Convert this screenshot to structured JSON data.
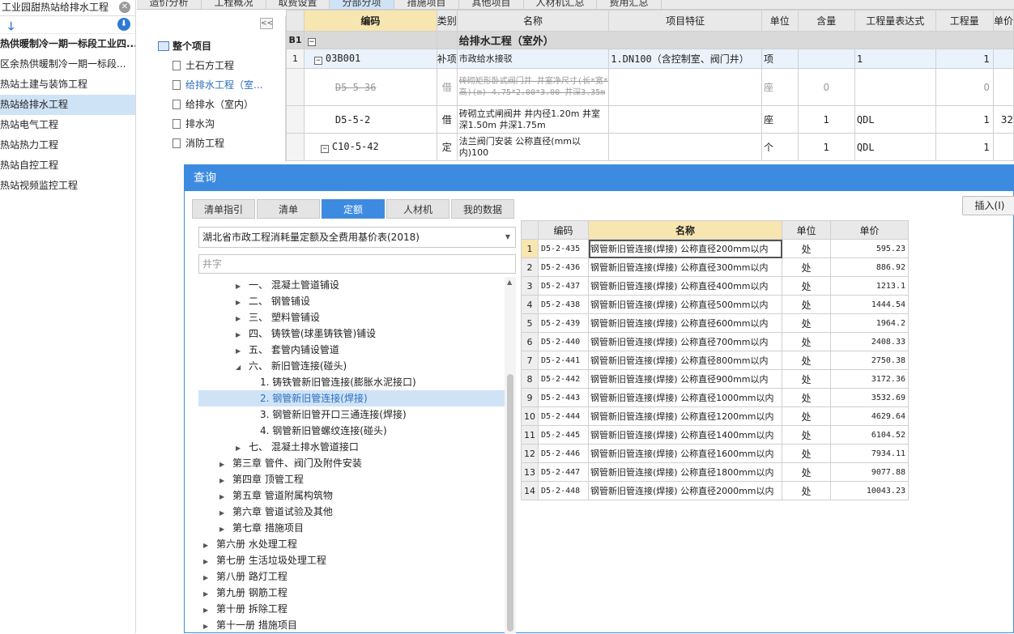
{
  "left_panel": {
    "title": "工业园甜热站给排水工程",
    "items": [
      {
        "label": "热供暖制冷一期一标段工业四...",
        "bold": true
      },
      {
        "label": "区余热供暖制冷一期一标段..."
      },
      {
        "label": "热站土建与装饰工程"
      },
      {
        "label": "热站给排水工程",
        "selected": true
      },
      {
        "label": "热站电气工程"
      },
      {
        "label": "热站热力工程"
      },
      {
        "label": "热站自控工程"
      },
      {
        "label": "热站视频监控工程"
      }
    ]
  },
  "top_tabs": [
    {
      "label": "造价分析"
    },
    {
      "label": "工程概况"
    },
    {
      "label": "取费设置"
    },
    {
      "label": "分部分项",
      "active": true
    },
    {
      "label": "措施项目"
    },
    {
      "label": "其他项目"
    },
    {
      "label": "人材机汇总"
    },
    {
      "label": "费用汇总"
    }
  ],
  "project_tree": {
    "collapse_label": "<<",
    "root": "整个项目",
    "children": [
      {
        "label": "土石方工程"
      },
      {
        "label": "给排水工程（室...",
        "selected": true
      },
      {
        "label": "给排水（室内）"
      },
      {
        "label": "排水沟"
      },
      {
        "label": "消防工程"
      }
    ]
  },
  "top_grid": {
    "headers": [
      "编码",
      "类别",
      "名称",
      "项目特征",
      "单位",
      "含量",
      "工程量表达式",
      "工程量",
      "单价"
    ],
    "section": {
      "idx": "B1",
      "name": "给排水工程（室外）"
    },
    "rows": [
      {
        "idx": "1",
        "code": "03B001",
        "type": "补项",
        "name": "市政给水接驳",
        "feature": "1.DN100（含控制室、阀门井）",
        "unit": "项",
        "content": "",
        "expr": "1",
        "qty": "1",
        "price": ""
      },
      {
        "idx": "",
        "code": "D5-5-36",
        "type": "借",
        "name": "砖砌矩形卧式阀门井 井室净尺寸(长*宽*高)(m) 4.75*2.00*3.00 井深3.35m",
        "feature": "",
        "unit": "座",
        "content": "0",
        "expr": "",
        "qty": "0",
        "price": "",
        "strike": true
      },
      {
        "idx": "",
        "code": "D5-5-2",
        "type": "借",
        "name": "砖砌立式闸阀井 井内径1.20m 井室深1.50m 井深1.75m",
        "feature": "",
        "unit": "座",
        "content": "1",
        "expr": "QDL",
        "qty": "1",
        "price": "32"
      },
      {
        "idx": "",
        "code": "C10-5-42",
        "type": "定",
        "name": "法兰阀门安装 公称直径(mm以内)100",
        "feature": "",
        "unit": "个",
        "content": "1",
        "expr": "QDL",
        "qty": "1",
        "price": ""
      }
    ]
  },
  "dialog": {
    "title": "查询",
    "tabs": [
      {
        "label": "清单指引"
      },
      {
        "label": "清单"
      },
      {
        "label": "定额",
        "active": true
      },
      {
        "label": "人材机"
      },
      {
        "label": "我的数据"
      }
    ],
    "insert_label": "插入(I)",
    "library": "湖北省市政工程消耗量定额及全费用基价表(2018)",
    "search_placeholder": "井字",
    "tree": [
      {
        "label": "一、 混凝土管道铺设",
        "level": 3,
        "expand": "right"
      },
      {
        "label": "二、 钢管铺设",
        "level": 3,
        "expand": "right"
      },
      {
        "label": "三、 塑料管铺设",
        "level": 3,
        "expand": "right"
      },
      {
        "label": "四、 铸铁管(球墨铸铁管)铺设",
        "level": 3,
        "expand": "right"
      },
      {
        "label": "五、 套管内铺设管道",
        "level": 3,
        "expand": "right"
      },
      {
        "label": "六、 新旧管连接(碰头)",
        "level": 3,
        "expand": "down"
      },
      {
        "label": "1. 铸铁管新旧管连接(膨胀水泥接口)",
        "level": 4
      },
      {
        "label": "2. 钢管新旧管连接(焊接)",
        "level": 4,
        "selected": true
      },
      {
        "label": "3. 钢管新旧管开口三通连接(焊接)",
        "level": 4
      },
      {
        "label": "4. 钢管新旧管螺纹连接(碰头)",
        "level": 4
      },
      {
        "label": "七、 混凝土排水管道接口",
        "level": 3,
        "expand": "right"
      },
      {
        "label": "第三章 管件、阀门及附件安装",
        "level": 2,
        "expand": "right"
      },
      {
        "label": "第四章 顶管工程",
        "level": 2,
        "expand": "right"
      },
      {
        "label": "第五章 管道附属构筑物",
        "level": 2,
        "expand": "right"
      },
      {
        "label": "第六章 管道试验及其他",
        "level": 2,
        "expand": "right"
      },
      {
        "label": "第七章 措施项目",
        "level": 2,
        "expand": "right"
      },
      {
        "label": "第六册 水处理工程",
        "level": 1,
        "expand": "right"
      },
      {
        "label": "第七册 生活垃圾处理工程",
        "level": 1,
        "expand": "right"
      },
      {
        "label": "第八册 路灯工程",
        "level": 1,
        "expand": "right"
      },
      {
        "label": "第九册 钢筋工程",
        "level": 1,
        "expand": "right"
      },
      {
        "label": "第十册 拆除工程",
        "level": 1,
        "expand": "right"
      },
      {
        "label": "第十一册 措施项目",
        "level": 1,
        "expand": "right"
      }
    ],
    "result_headers": [
      "编码",
      "名称",
      "单位",
      "单价"
    ],
    "results": [
      {
        "idx": "1",
        "code": "D5-2-435",
        "name": "钢管新旧管连接(焊接) 公称直径200mm以内",
        "unit": "处",
        "price": "595.23"
      },
      {
        "idx": "2",
        "code": "D5-2-436",
        "name": "钢管新旧管连接(焊接) 公称直径300mm以内",
        "unit": "处",
        "price": "886.92"
      },
      {
        "idx": "3",
        "code": "D5-2-437",
        "name": "钢管新旧管连接(焊接) 公称直径400mm以内",
        "unit": "处",
        "price": "1213.1"
      },
      {
        "idx": "4",
        "code": "D5-2-438",
        "name": "钢管新旧管连接(焊接) 公称直径500mm以内",
        "unit": "处",
        "price": "1444.54"
      },
      {
        "idx": "5",
        "code": "D5-2-439",
        "name": "钢管新旧管连接(焊接) 公称直径600mm以内",
        "unit": "处",
        "price": "1964.2"
      },
      {
        "idx": "6",
        "code": "D5-2-440",
        "name": "钢管新旧管连接(焊接) 公称直径700mm以内",
        "unit": "处",
        "price": "2408.33"
      },
      {
        "idx": "7",
        "code": "D5-2-441",
        "name": "钢管新旧管连接(焊接) 公称直径800mm以内",
        "unit": "处",
        "price": "2750.38"
      },
      {
        "idx": "8",
        "code": "D5-2-442",
        "name": "钢管新旧管连接(焊接) 公称直径900mm以内",
        "unit": "处",
        "price": "3172.36"
      },
      {
        "idx": "9",
        "code": "D5-2-443",
        "name": "钢管新旧管连接(焊接) 公称直径1000mm以内",
        "unit": "处",
        "price": "3532.69"
      },
      {
        "idx": "10",
        "code": "D5-2-444",
        "name": "钢管新旧管连接(焊接) 公称直径1200mm以内",
        "unit": "处",
        "price": "4629.64"
      },
      {
        "idx": "11",
        "code": "D5-2-445",
        "name": "钢管新旧管连接(焊接) 公称直径1400mm以内",
        "unit": "处",
        "price": "6104.52"
      },
      {
        "idx": "12",
        "code": "D5-2-446",
        "name": "钢管新旧管连接(焊接) 公称直径1600mm以内",
        "unit": "处",
        "price": "7934.11"
      },
      {
        "idx": "13",
        "code": "D5-2-447",
        "name": "钢管新旧管连接(焊接) 公称直径1800mm以内",
        "unit": "处",
        "price": "9077.88"
      },
      {
        "idx": "14",
        "code": "D5-2-448",
        "name": "钢管新旧管连接(焊接) 公称直径2000mm以内",
        "unit": "处",
        "price": "10043.23"
      }
    ]
  }
}
